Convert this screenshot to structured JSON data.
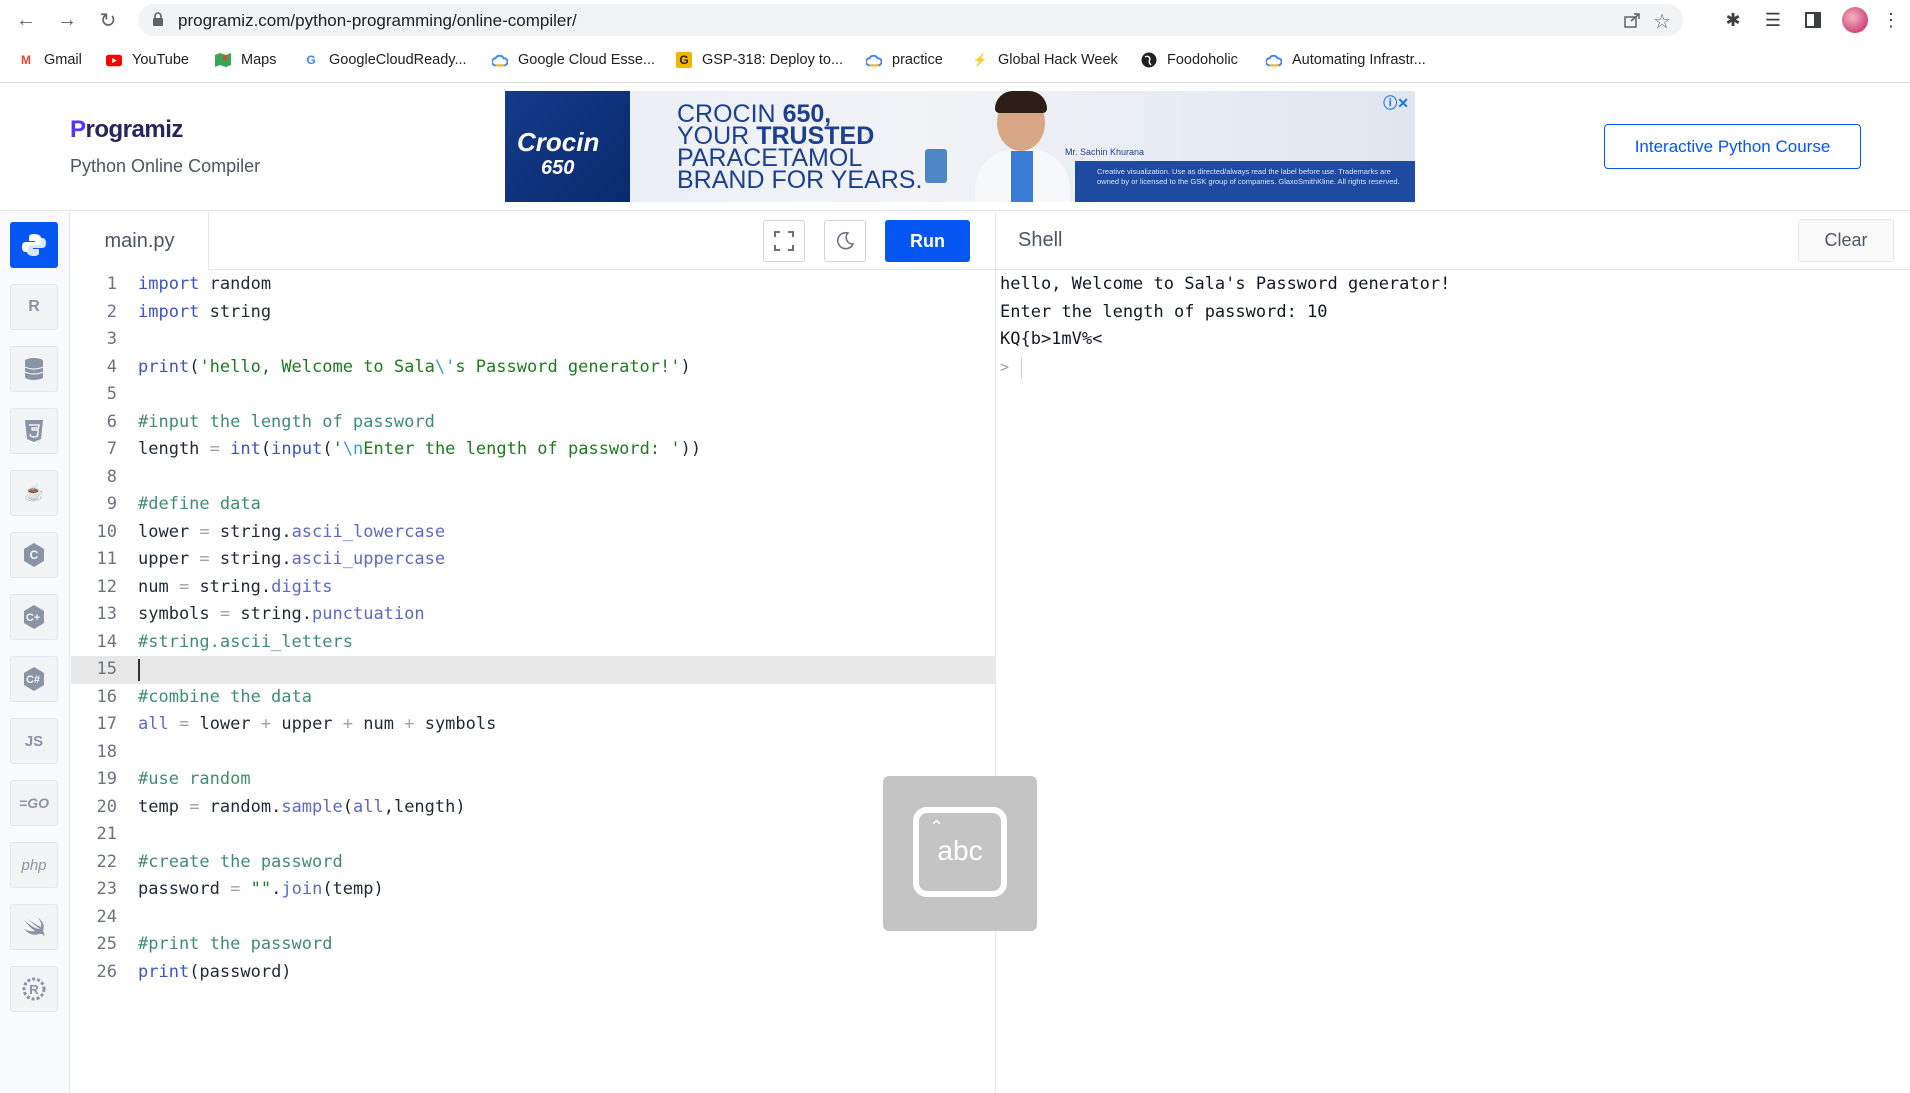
{
  "browser": {
    "url": "programiz.com/python-programming/online-compiler/",
    "bookmarks": [
      {
        "label": "Gmail",
        "icon": "gmail-icon"
      },
      {
        "label": "YouTube",
        "icon": "youtube-icon"
      },
      {
        "label": "Maps",
        "icon": "maps-icon"
      },
      {
        "label": "GoogleCloudReady...",
        "icon": "google-icon"
      },
      {
        "label": "Google Cloud Esse...",
        "icon": "google-cloud-icon"
      },
      {
        "label": "GSP-318: Deploy to...",
        "icon": "qwiklabs-icon"
      },
      {
        "label": "practice",
        "icon": "google-cloud-icon"
      },
      {
        "label": "Global Hack Week",
        "icon": "bolt-icon"
      },
      {
        "label": "Foodoholic",
        "icon": "globe-icon"
      },
      {
        "label": "Automating Infrastr...",
        "icon": "google-cloud-icon"
      }
    ]
  },
  "site": {
    "logo_p": "P",
    "logo_rest": "rogramiz",
    "subtitle": "Python Online Compiler",
    "course_button": "Interactive Python Course"
  },
  "ad": {
    "brand_line1": "Crocin",
    "brand_line2": "650",
    "headline_1": "CROCIN ",
    "headline_1b": "650,",
    "headline_2": "YOUR ",
    "headline_2b": "TRUSTED",
    "headline_3": "PARACETAMOL",
    "headline_4": "BRAND FOR YEARS.",
    "person_name": "Mr. Sachin Khurana",
    "fine_print": "Creative visualization. Use as directed/always read the label before use. Trademarks are owned by or licensed to the GSK group of companies. GlaxoSmithKline. All rights reserved."
  },
  "editor": {
    "filename": "main.py",
    "run_label": "Run",
    "current_line": 15
  },
  "shell": {
    "title": "Shell",
    "clear_label": "Clear",
    "output": [
      "hello, Welcome to Sala's Password generator!",
      "Enter the length of password: 10",
      "KQ{b>1mV%<"
    ],
    "prompt": ">"
  },
  "keyboard_overlay": {
    "label": "abc"
  },
  "languages": [
    "python",
    "r",
    "sql",
    "html",
    "java",
    "c",
    "cpp",
    "csharp",
    "js",
    "go",
    "php",
    "swift",
    "rust"
  ],
  "colors": {
    "accent": "#0556f3",
    "keyword": "#3b54c7",
    "string": "#1f7a1f",
    "comment": "#3f8f6a"
  }
}
